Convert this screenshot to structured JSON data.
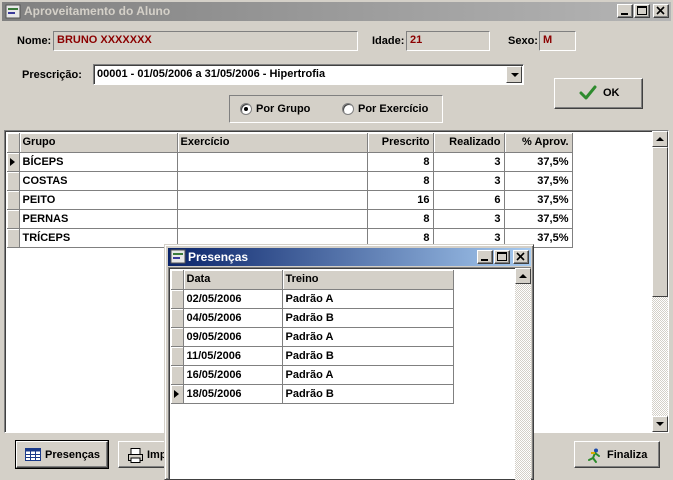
{
  "window": {
    "title": "Aproveitamento do Aluno",
    "buttons": {
      "minimize": "_",
      "maximize": "□",
      "close": "✕"
    }
  },
  "student": {
    "name_label": "Nome:",
    "name_value": "BRUNO XXXXXXX",
    "age_label": "Idade:",
    "age_value": "21",
    "sex_label": "Sexo:",
    "sex_value": "M"
  },
  "prescription": {
    "label": "Prescrição:",
    "value": "00001 - 01/05/2006 a 31/05/2006 - Hipertrofia"
  },
  "ok_button": {
    "label": "OK",
    "icon": "check-icon",
    "color": "#2e8b2e"
  },
  "view_mode": {
    "options": [
      "Por Grupo",
      "Por Exercício"
    ],
    "selected": "Por Grupo"
  },
  "grid": {
    "columns": [
      "Grupo",
      "Exercício",
      "Prescrito",
      "Realizado",
      "% Aprov."
    ],
    "rows": [
      {
        "grupo": "BÍCEPS",
        "exercicio": "",
        "prescrito": "8",
        "realizado": "3",
        "aprov": "37,5%",
        "current": true
      },
      {
        "grupo": "COSTAS",
        "exercicio": "",
        "prescrito": "8",
        "realizado": "3",
        "aprov": "37,5%",
        "current": false
      },
      {
        "grupo": "PEITO",
        "exercicio": "",
        "prescrito": "16",
        "realizado": "6",
        "aprov": "37,5%",
        "current": false
      },
      {
        "grupo": "PERNAS",
        "exercicio": "",
        "prescrito": "8",
        "realizado": "3",
        "aprov": "37,5%",
        "current": false
      },
      {
        "grupo": "TRÍCEPS",
        "exercicio": "",
        "prescrito": "8",
        "realizado": "3",
        "aprov": "37,5%",
        "current": false
      }
    ]
  },
  "bottom": {
    "presencas_label": "Presenças",
    "imprimir_label": "Imp",
    "finaliza_label": "Finaliza"
  },
  "presencas_window": {
    "title": "Presenças",
    "columns": [
      "Data",
      "Treino"
    ],
    "rows": [
      {
        "data": "02/05/2006",
        "treino": "Padrão A",
        "current": false
      },
      {
        "data": "04/05/2006",
        "treino": "Padrão B",
        "current": false
      },
      {
        "data": "09/05/2006",
        "treino": "Padrão A",
        "current": false
      },
      {
        "data": "11/05/2006",
        "treino": "Padrão B",
        "current": false
      },
      {
        "data": "16/05/2006",
        "treino": "Padrão A",
        "current": false
      },
      {
        "data": "18/05/2006",
        "treino": "Padrão B",
        "current": true
      }
    ]
  }
}
